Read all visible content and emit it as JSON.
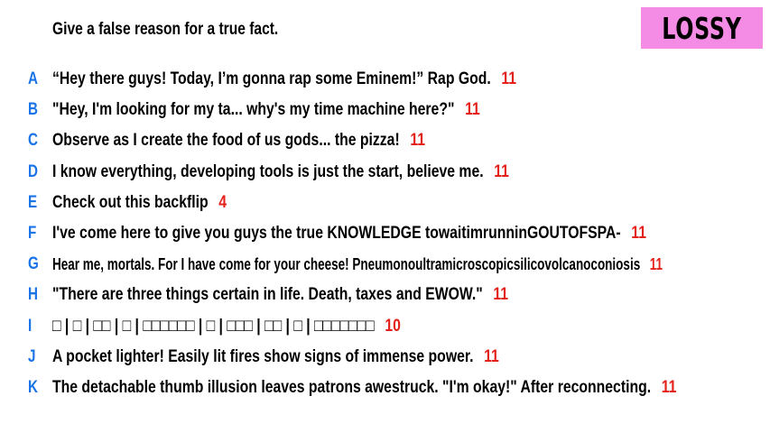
{
  "prompt": "Give a false reason for a true fact.",
  "badge": {
    "label": "LOSSY",
    "color": "#f48ce6"
  },
  "colors": {
    "letter": "#1a74e8",
    "score": "#e3201a",
    "text": "#000000"
  },
  "answers": [
    {
      "letter": "A",
      "text": "“Hey there guys! Today, I’m gonna rap some Eminem!” Rap God.",
      "score": "11"
    },
    {
      "letter": "B",
      "text": "\"Hey, I'm looking for my ta... why's my time machine here?\"",
      "score": "11"
    },
    {
      "letter": "C",
      "text": "Observe as I create the food of us gods... the pizza!",
      "score": "11"
    },
    {
      "letter": "D",
      "text": "I know everything, developing tools is just the start, believe me.",
      "score": "11"
    },
    {
      "letter": "E",
      "text": "Check out this backflip",
      "score": "4"
    },
    {
      "letter": "F",
      "text": "I've come here to give you guys the true KNOWLEDGE towaitimrunninGOUTOFSPA-",
      "score": "11"
    },
    {
      "letter": "G",
      "text": "Hear me, mortals. For I have come for your cheese! Pneumonoultramicroscopicsilicovolcanoconiosis",
      "score": "11"
    },
    {
      "letter": "H",
      "text": "\"There are three things certain in life. Death, taxes and EWOW.\"",
      "score": "11"
    },
    {
      "letter": "I",
      "text": "□ | □ | □□ | □ | □□□□□□ | □ | □□□ | □□ | □ | □□□□□□□",
      "score": "10"
    },
    {
      "letter": "J",
      "text": "A pocket lighter! Easily lit fires show signs of immense power.",
      "score": "11"
    },
    {
      "letter": "K",
      "text": "The detachable thumb illusion leaves patrons awestruck. \"I'm okay!\" After reconnecting.",
      "score": "11"
    }
  ]
}
